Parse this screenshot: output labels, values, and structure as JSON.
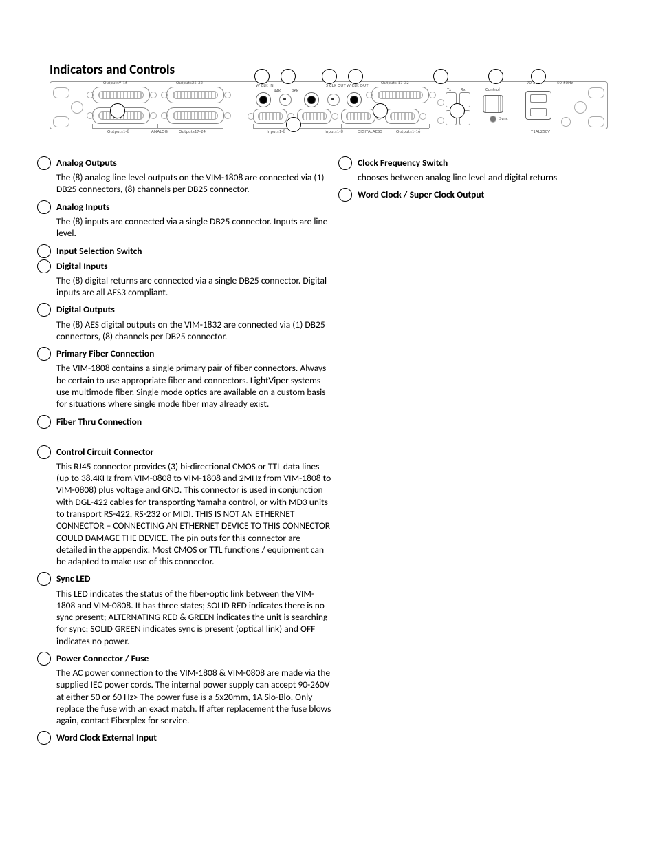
{
  "title": "Indicators and Controls",
  "diagram_labels": {
    "outputs9_16": "Outputs9-16",
    "outputs25_32": "Outputs25-32",
    "outputs1_8": "Outputs1-8",
    "outputs17_24": "Outputs17-24",
    "analog": "ANALOG",
    "inputs1_8": "Inputs1-8",
    "digital_aes3": "DIGITALAES3",
    "outputs1_16": "Outputs1-16",
    "outputs17_32": "Outputs 17-32",
    "wclk_in": "W\nCLK\nIN",
    "k44": "44K",
    "k96": "96K",
    "sclk_out": "S\nCLK\nOUT",
    "wclk_out": "W\nCLK\nOUT",
    "tx": "Tx",
    "rx": "Rx",
    "control": "Control",
    "sync": "Sync",
    "v90_250": "90-250V",
    "hz50_60": "50-60Hz",
    "fuse": "T1AL250V"
  },
  "left_column": [
    {
      "title": "Analog Outputs",
      "body": "The (8) analog line level outputs on the VIM-1808 are connected via (1) DB25 connectors, (8) channels per DB25 connector."
    },
    {
      "title": "Analog Inputs",
      "body": "The (8) inputs are connected via a single DB25 connector. Inputs are line level."
    },
    {
      "title": "Input Selection Switch",
      "body": ""
    },
    {
      "title": "Digital Inputs",
      "body": "The (8) digital returns are connected via a single DB25 connector. Digital inputs are all AES3 compliant."
    },
    {
      "title": "Digital Outputs",
      "body": "The (8) AES digital outputs on the VIM-1832 are connected via (1) DB25 connectors, (8) channels per DB25 connector."
    },
    {
      "title": "Primary Fiber Connection",
      "body": "The VIM-1808 contains a single primary pair of fiber connectors. Always be certain to use appropriate fiber and connectors. LightViper systems use multimode fiber. Single mode optics are available on a custom basis for situations where single mode fiber may already exist."
    },
    {
      "title": "Fiber Thru Connection",
      "body": ""
    },
    {
      "title": "Control Circuit Connector",
      "body": "This RJ45 connector provides (3) bi-directional CMOS or TTL data lines (up to 38.4KHz from VIM-0808 to VIM-1808 and 2MHz from VIM-1808 to VIM-0808) plus voltage and GND. This connector is used in conjunction with DGL-422 cables for transporting Yamaha control, or with MD3 units to transport RS-422, RS-232 or MIDI. THIS IS NOT AN ETHERNET CONNECTOR – CONNECTING AN ETHERNET DEVICE TO THIS CONNECTOR COULD DAMAGE THE DEVICE. The pin outs for this connector are detailed in the appendix. Most CMOS or TTL functions / equipment can be adapted to make use of this connector."
    },
    {
      "title": "Sync LED",
      "body": "This LED indicates the status of the fiber-optic link between the VIM-1808 and VIM-0808. It has three states; SOLID RED indicates there is no sync present; ALTERNATING RED & GREEN indicates the unit is searching for sync; SOLID GREEN indicates sync is present (optical link) and OFF indicates no power."
    },
    {
      "title": "Power Connector / Fuse",
      "body": "The AC power connection to the VIM-1808 & VIM-0808 are made via the supplied IEC power cords. The internal power supply can accept 90-260V at either 50 or 60 Hz> The power fuse is a 5x20mm, 1A Slo-Blo. Only replace the fuse with an exact match. If after replacement the fuse blows again, contact Fiberplex for service."
    },
    {
      "title": "Word Clock External Input",
      "body": ""
    }
  ],
  "right_column": [
    {
      "title": "Clock Frequency Switch",
      "body": "chooses between analog line level and digital returns"
    },
    {
      "title": "Word Clock  / Super Clock Output",
      "body": ""
    }
  ]
}
